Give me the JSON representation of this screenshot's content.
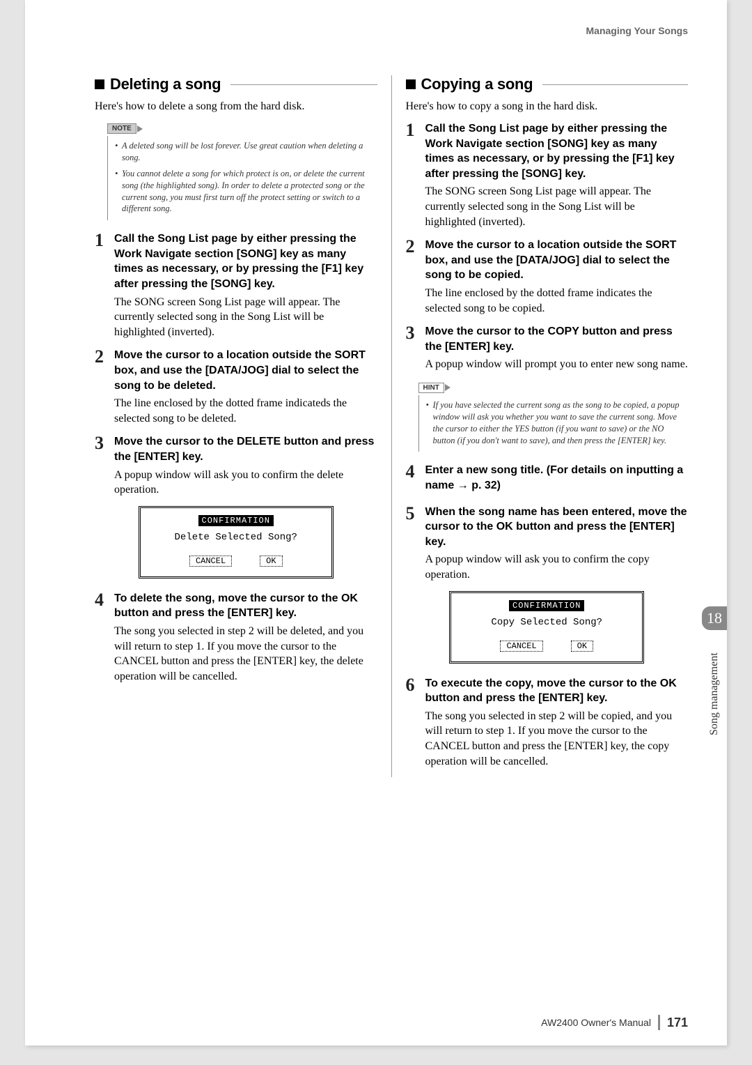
{
  "header": {
    "section_name": "Managing Your Songs"
  },
  "left": {
    "title": "Deleting a song",
    "intro": "Here's how to delete a song from the hard disk.",
    "note_label": "NOTE",
    "notes": [
      "A deleted song will be lost forever. Use great caution when deleting a song.",
      "You cannot delete a song for which protect is on, or delete the current song (the highlighted song). In order to delete a protected song or the current song, you must first turn off the protect setting or switch to a different song."
    ],
    "steps": [
      {
        "num": "1",
        "head": "Call the Song List page by either pressing the Work Navigate section [SONG] key as many times as necessary, or by pressing the [F1] key after pressing the [SONG] key.",
        "text": "The SONG screen Song List page will appear. The currently selected song in the Song List will be highlighted (inverted)."
      },
      {
        "num": "2",
        "head": "Move the cursor to a location outside the SORT box, and use the [DATA/JOG] dial to select the song to be deleted.",
        "text": "The line enclosed by the dotted frame indicateds the selected song to be deleted."
      },
      {
        "num": "3",
        "head": "Move the cursor to the DELETE button and press the [ENTER] key.",
        "text": "A popup window will ask you to confirm the delete operation."
      },
      {
        "num": "4",
        "head": "To delete the song, move the cursor to the OK button and press the [ENTER] key.",
        "text": "The song you selected in step 2 will be deleted, and you will return to step 1. If you move the cursor to the CANCEL button and press the [ENTER] key, the delete operation will be cancelled."
      }
    ],
    "dialog": {
      "title": "CONFIRMATION",
      "message": "Delete Selected Song?",
      "cancel": "CANCEL",
      "ok": "OK"
    }
  },
  "right": {
    "title": "Copying a song",
    "intro": "Here's how to copy a song in the hard disk.",
    "hint_label": "HINT",
    "hints": [
      "If you have selected the current song as the song to be copied, a popup window will ask you whether you want to save the current song. Move the cursor to either the YES button (if you want to save) or the NO button (if you don't want to save), and then press the [ENTER] key."
    ],
    "steps": [
      {
        "num": "1",
        "head": "Call the Song List page by either pressing the Work Navigate section [SONG] key as many times as necessary, or by pressing the [F1] key after pressing the [SONG] key.",
        "text": "The SONG screen Song List page will appear. The currently selected song in the Song List will be highlighted (inverted)."
      },
      {
        "num": "2",
        "head": "Move the cursor to a location outside the SORT box, and use the [DATA/JOG] dial to select the song to be copied.",
        "text": "The line enclosed by the dotted frame indicates the selected song to be copied."
      },
      {
        "num": "3",
        "head": "Move the cursor to the COPY button and press the [ENTER] key.",
        "text": "A popup window will prompt you to enter new song name."
      },
      {
        "num": "4",
        "head_pre": "Enter a new song title. (For details on inputting a name ",
        "head_post": " p. 32)",
        "text": ""
      },
      {
        "num": "5",
        "head": "When the song name has been entered, move the cursor to the OK button and press the [ENTER] key.",
        "text": "A popup window will ask you to confirm the copy operation."
      },
      {
        "num": "6",
        "head": "To execute the copy, move the cursor to the OK button and press the [ENTER] key.",
        "text": "The song you selected in step 2 will be copied, and you will return to step 1. If you move the cursor to the CANCEL button and press the [ENTER] key, the copy operation will be cancelled."
      }
    ],
    "dialog": {
      "title": "CONFIRMATION",
      "message": "Copy Selected Song?",
      "cancel": "CANCEL",
      "ok": "OK"
    }
  },
  "side": {
    "chapter": "18",
    "label": "Song management"
  },
  "footer": {
    "product": "AW2400  Owner's Manual",
    "page": "171"
  }
}
